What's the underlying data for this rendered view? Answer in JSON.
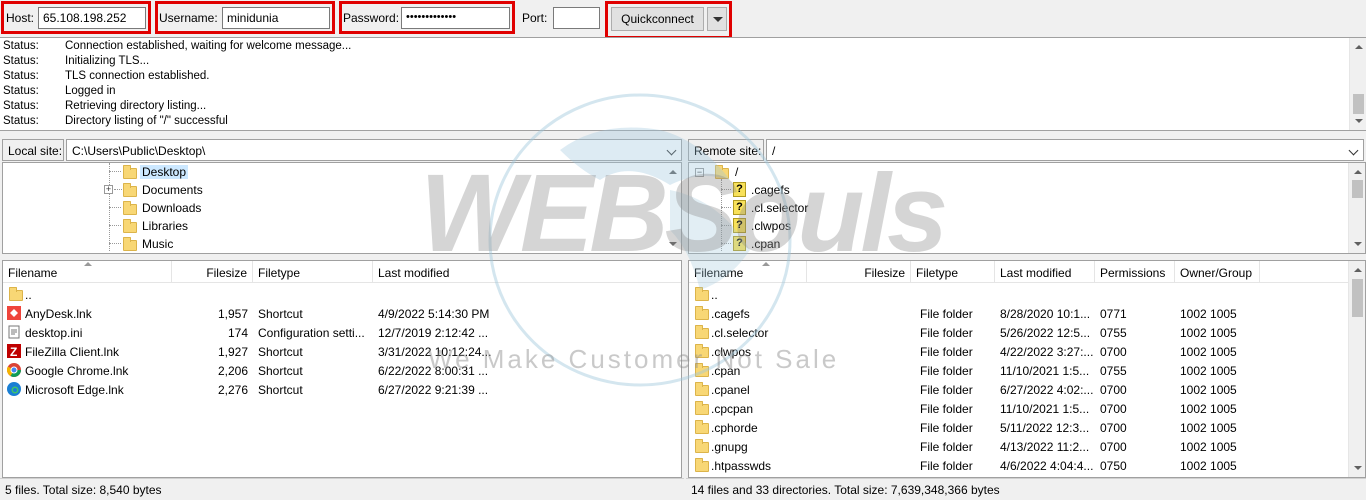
{
  "toolbar": {
    "host_label": "Host:",
    "host_value": "65.108.198.252",
    "username_label": "Username:",
    "username_value": "minidunia",
    "password_label": "Password:",
    "password_value": "•••••••••••••",
    "port_label": "Port:",
    "port_value": "",
    "quickconnect_label": "Quickconnect"
  },
  "log": [
    {
      "type": "Status:",
      "msg": "Connection established, waiting for welcome message..."
    },
    {
      "type": "Status:",
      "msg": "Initializing TLS..."
    },
    {
      "type": "Status:",
      "msg": "TLS connection established."
    },
    {
      "type": "Status:",
      "msg": "Logged in"
    },
    {
      "type": "Status:",
      "msg": "Retrieving directory listing..."
    },
    {
      "type": "Status:",
      "msg": "Directory listing of \"/\" successful"
    }
  ],
  "local": {
    "site_label": "Local site:",
    "site_path": "C:\\Users\\Public\\Desktop\\",
    "tree": [
      "Desktop",
      "Documents",
      "Downloads",
      "Libraries",
      "Music"
    ],
    "headers": {
      "filename": "Filename",
      "filesize": "Filesize",
      "filetype": "Filetype",
      "modified": "Last modified"
    },
    "files": [
      {
        "name": "..",
        "size": "",
        "type": "",
        "modified": "",
        "icon": "folder"
      },
      {
        "name": "AnyDesk.lnk",
        "size": "1,957",
        "type": "Shortcut",
        "modified": "4/9/2022 5:14:30 PM",
        "icon": "anydesk-icon"
      },
      {
        "name": "desktop.ini",
        "size": "174",
        "type": "Configuration setti...",
        "modified": "12/7/2019 2:12:42 ...",
        "icon": "ini-file-icon"
      },
      {
        "name": "FileZilla Client.lnk",
        "size": "1,927",
        "type": "Shortcut",
        "modified": "3/31/2022 10:12:24...",
        "icon": "filezilla-icon"
      },
      {
        "name": "Google Chrome.lnk",
        "size": "2,206",
        "type": "Shortcut",
        "modified": "6/22/2022 8:00:31 ...",
        "icon": "chrome-icon"
      },
      {
        "name": "Microsoft Edge.lnk",
        "size": "2,276",
        "type": "Shortcut",
        "modified": "6/27/2022 9:21:39 ...",
        "icon": "edge-icon"
      }
    ],
    "status": "5 files. Total size: 8,540 bytes"
  },
  "remote": {
    "site_label": "Remote site:",
    "site_path": "/",
    "tree_root": "/",
    "tree": [
      ".cagefs",
      ".cl.selector",
      ".clwpos",
      ".cpan"
    ],
    "headers": {
      "filename": "Filename",
      "filesize": "Filesize",
      "filetype": "Filetype",
      "modified": "Last modified",
      "permissions": "Permissions",
      "owner": "Owner/Group"
    },
    "files": [
      {
        "name": "..",
        "type": "",
        "modified": "",
        "perm": "",
        "owner": ""
      },
      {
        "name": ".cagefs",
        "type": "File folder",
        "modified": "8/28/2020 10:1...",
        "perm": "0771",
        "owner": "1002 1005"
      },
      {
        "name": ".cl.selector",
        "type": "File folder",
        "modified": "5/26/2022 12:5...",
        "perm": "0755",
        "owner": "1002 1005"
      },
      {
        "name": ".clwpos",
        "type": "File folder",
        "modified": "4/22/2022 3:27:...",
        "perm": "0700",
        "owner": "1002 1005"
      },
      {
        "name": ".cpan",
        "type": "File folder",
        "modified": "11/10/2021 1:5...",
        "perm": "0755",
        "owner": "1002 1005"
      },
      {
        "name": ".cpanel",
        "type": "File folder",
        "modified": "6/27/2022 4:02:...",
        "perm": "0700",
        "owner": "1002 1005"
      },
      {
        "name": ".cpcpan",
        "type": "File folder",
        "modified": "11/10/2021 1:5...",
        "perm": "0700",
        "owner": "1002 1005"
      },
      {
        "name": ".cphorde",
        "type": "File folder",
        "modified": "5/11/2022 12:3...",
        "perm": "0700",
        "owner": "1002 1005"
      },
      {
        "name": ".gnupg",
        "type": "File folder",
        "modified": "4/13/2022 11:2...",
        "perm": "0700",
        "owner": "1002 1005"
      },
      {
        "name": ".htpasswds",
        "type": "File folder",
        "modified": "4/6/2022 4:04:4...",
        "perm": "0750",
        "owner": "1002 1005"
      }
    ],
    "status": "14 files and 33 directories. Total size: 7,639,348,366 bytes"
  },
  "watermark": {
    "brand": "WEBSouls",
    "tagline": "We Make Customer Not Sale"
  },
  "colors": {
    "highlight": "#e00000",
    "folder": "#f8d775",
    "selected": "#cce8ff"
  }
}
